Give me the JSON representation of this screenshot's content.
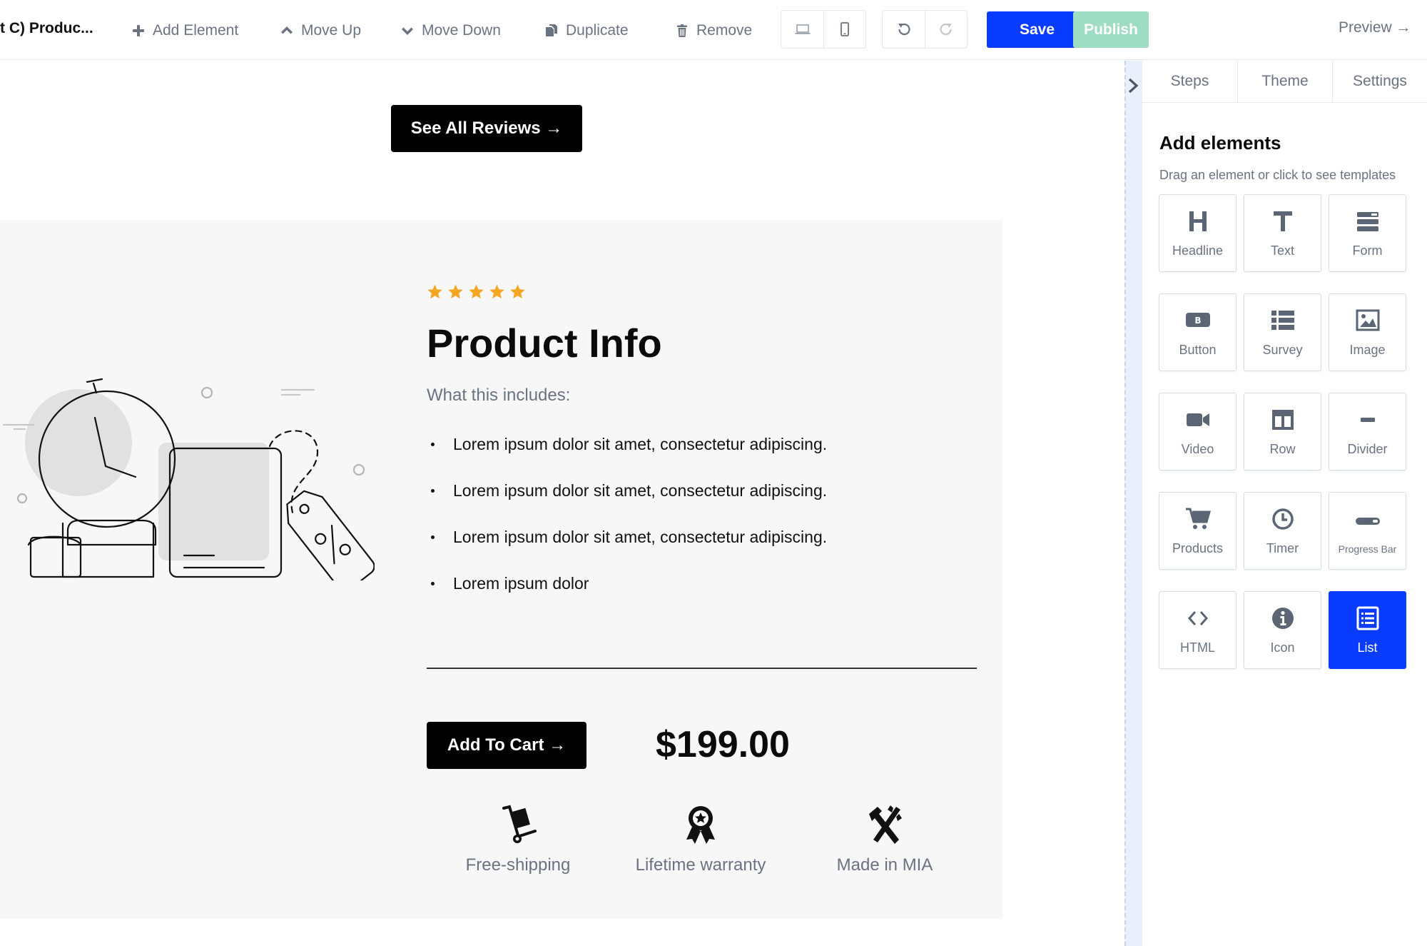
{
  "toolbar": {
    "title": "t C) Produc...",
    "add_element": "Add Element",
    "move_up": "Move Up",
    "move_down": "Move Down",
    "duplicate": "Duplicate",
    "remove": "Remove",
    "save": "Save",
    "publish": "Publish",
    "preview": "Preview →"
  },
  "canvas": {
    "see_reviews": "See All Reviews →",
    "product": {
      "rating": 5,
      "title": "Product Info",
      "subtitle": "What this includes:",
      "items": [
        "Lorem ipsum dolor sit amet, consectetur adipiscing.",
        "Lorem ipsum dolor sit amet, consectetur adipiscing.",
        "Lorem ipsum dolor sit amet, consectetur adipiscing.",
        "Lorem ipsum dolor"
      ],
      "add_to_cart": "Add To Cart →",
      "price": "$199.00",
      "features": [
        {
          "icon": "dolly-icon",
          "label": "Free-shipping"
        },
        {
          "icon": "award-icon",
          "label": "Lifetime warranty"
        },
        {
          "icon": "tools-icon",
          "label": "Made in MIA"
        }
      ]
    }
  },
  "panel": {
    "tabs": [
      "Steps",
      "Theme",
      "Settings"
    ],
    "title": "Add elements",
    "subtitle": "Drag an element or click to see templates",
    "elements": [
      {
        "label": "Headline",
        "icon": "headline-icon"
      },
      {
        "label": "Text",
        "icon": "text-icon"
      },
      {
        "label": "Form",
        "icon": "form-icon"
      },
      {
        "label": "Button",
        "icon": "button-icon"
      },
      {
        "label": "Survey",
        "icon": "survey-icon"
      },
      {
        "label": "Image",
        "icon": "image-icon"
      },
      {
        "label": "Video",
        "icon": "video-icon"
      },
      {
        "label": "Row",
        "icon": "row-icon"
      },
      {
        "label": "Divider",
        "icon": "divider-icon"
      },
      {
        "label": "Products",
        "icon": "cart-icon"
      },
      {
        "label": "Timer",
        "icon": "clock-icon"
      },
      {
        "label": "Progress Bar",
        "icon": "progress-bar-icon"
      },
      {
        "label": "HTML",
        "icon": "code-icon"
      },
      {
        "label": "Icon",
        "icon": "info-icon"
      },
      {
        "label": "List",
        "icon": "list-icon",
        "active": true
      }
    ]
  },
  "colors": {
    "primary": "#0a3cff",
    "publish": "#9fdcc4",
    "star": "#f5a623",
    "muted_text": "#6b7280"
  }
}
